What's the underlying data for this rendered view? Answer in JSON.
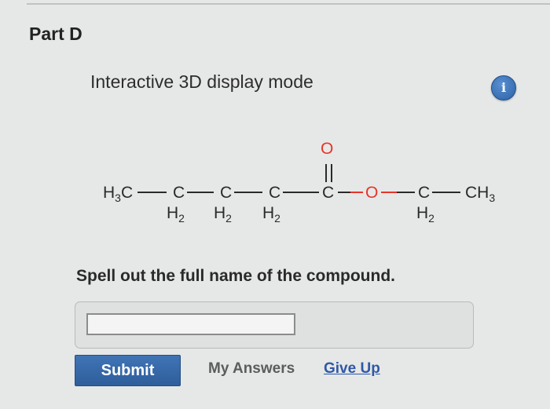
{
  "part": {
    "title": "Part D"
  },
  "viewer": {
    "mode_label": "Interactive 3D display mode",
    "info_icon_glyph": "i"
  },
  "molecule": {
    "c1": "H",
    "c1_sub": "3",
    "c1_tail": "C",
    "c2": "C",
    "c2_h": "H",
    "c2_h_sub": "2",
    "c3": "C",
    "c3_h": "H",
    "c3_h_sub": "2",
    "c4": "C",
    "c4_h": "H",
    "c4_h_sub": "2",
    "carbonyl_c": "C",
    "carbonyl_o": "O",
    "ester_o": "O",
    "c6": "C",
    "c6_h": "H",
    "c6_h_sub": "2",
    "c7": "CH",
    "c7_sub": "3"
  },
  "question": {
    "text": "Spell out the full name of the compound."
  },
  "answer": {
    "value": "",
    "placeholder": ""
  },
  "actions": {
    "submit": "Submit",
    "my_answers": "My Answers",
    "give_up": "Give Up"
  },
  "colors": {
    "oxygen": "#e8342b",
    "carbon": "#2a2a2a",
    "accent": "#2f5e9b",
    "info": "#3b72bd"
  }
}
